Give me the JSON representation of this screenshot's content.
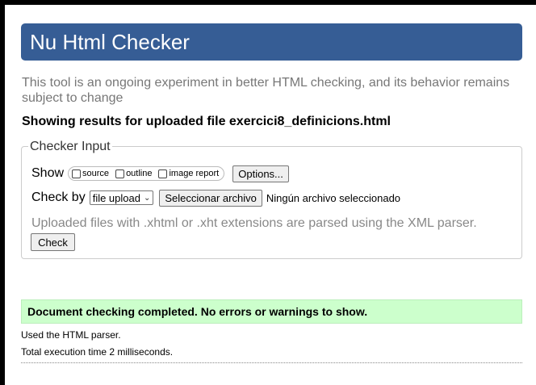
{
  "header": {
    "title": "Nu Html Checker"
  },
  "intro": "This tool is an ongoing experiment in better HTML checking, and its behavior remains subject to change",
  "results_heading": "Showing results for uploaded file exercici8_definicions.html",
  "checker_input": {
    "legend": "Checker Input",
    "show_label": "Show",
    "options": [
      {
        "label": "source",
        "checked": false
      },
      {
        "label": "outline",
        "checked": false
      },
      {
        "label": "image report",
        "checked": false
      }
    ],
    "options_button": "Options...",
    "check_by_label": "Check by",
    "check_by_selected": "file upload",
    "file_button": "Seleccionar archivo",
    "file_status": "Ningún archivo seleccionado",
    "xml_note": "Uploaded files with .xhtml or .xht extensions are parsed using the XML parser.",
    "check_button": "Check"
  },
  "result": {
    "success_message": "Document checking completed. No errors or warnings to show.",
    "parser_info": "Used the HTML parser.",
    "execution_time": "Total execution time 2 milliseconds."
  },
  "colors": {
    "banner": "#365d95",
    "success_bg": "#ccffcc",
    "muted_text": "#777777"
  }
}
